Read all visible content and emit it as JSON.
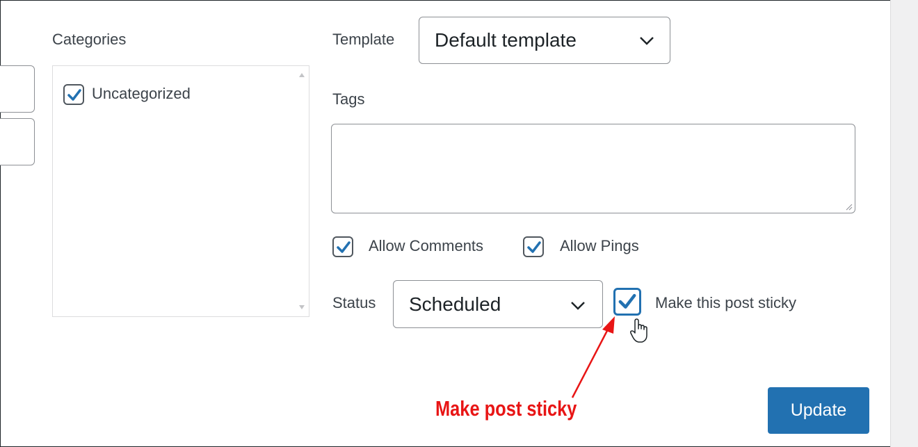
{
  "categories": {
    "heading": "Categories",
    "items": [
      {
        "label": "Uncategorized",
        "checked": true
      }
    ]
  },
  "template": {
    "label": "Template",
    "selected": "Default template"
  },
  "tags": {
    "label": "Tags",
    "value": ""
  },
  "options": {
    "allow_comments": {
      "label": "Allow Comments",
      "checked": true
    },
    "allow_pings": {
      "label": "Allow Pings",
      "checked": true
    },
    "sticky": {
      "label": "Make this post sticky",
      "checked": true
    }
  },
  "status": {
    "label": "Status",
    "selected": "Scheduled"
  },
  "update_button": "Update",
  "annotation": {
    "text": "Make post sticky",
    "color": "#e81515"
  },
  "colors": {
    "accent": "#2271b1",
    "text": "#3c434a",
    "border": "#8c8f94"
  },
  "icons": {
    "check": "checkmark-icon",
    "dropdown": "chevron-down-icon",
    "cursor": "hand-pointer-icon",
    "resize": "resize-grip-icon"
  }
}
